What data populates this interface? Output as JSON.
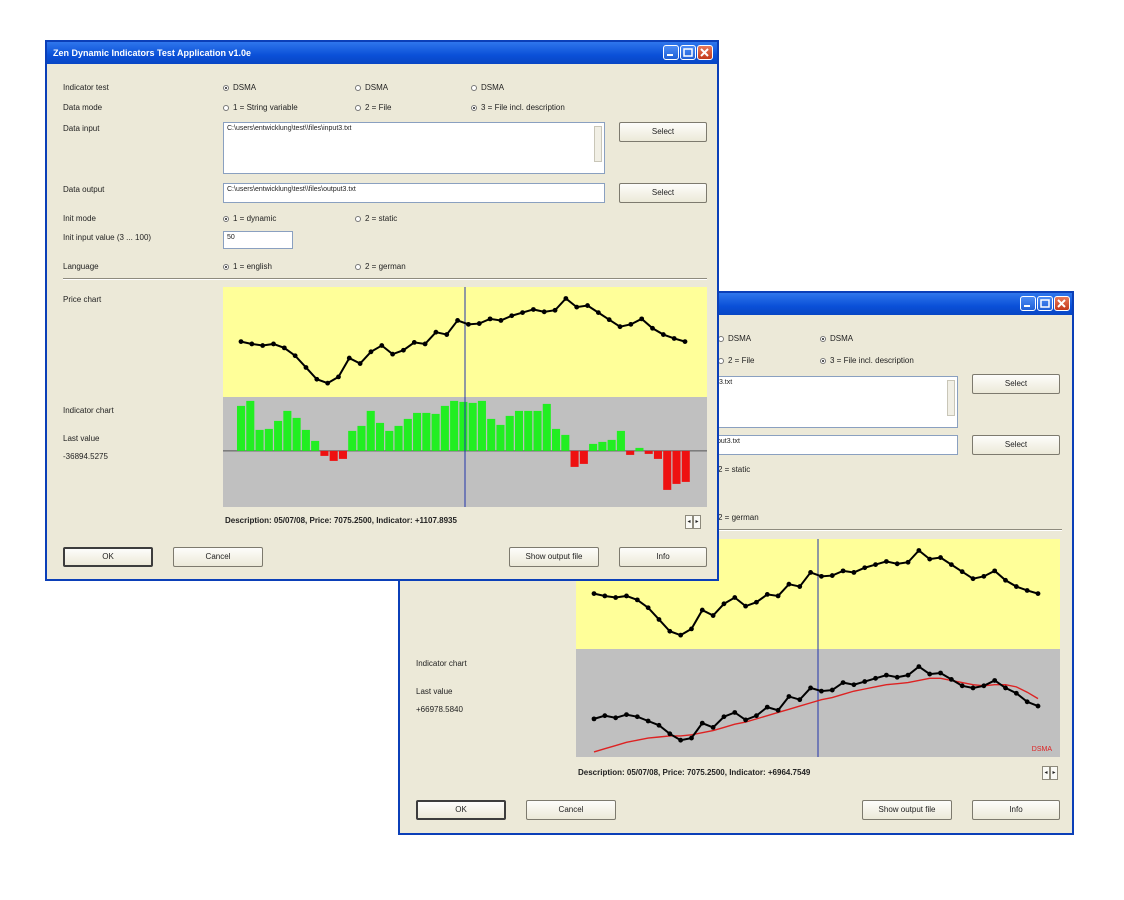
{
  "window1": {
    "title": "Zen Dynamic Indicators Test Application v1.0e",
    "labels": {
      "indicator_test": "Indicator test",
      "data_mode": "Data mode",
      "data_input": "Data input",
      "data_output": "Data output",
      "init_mode": "Init mode",
      "init_input_value": "Init input value (3 ... 100)",
      "language": "Language",
      "price_chart": "Price chart",
      "indicator_chart": "Indicator chart",
      "last_value": "Last value",
      "last_value_number": "-36894.5275"
    },
    "indicator_options": [
      "DSMA",
      "DSMA",
      "DSMA"
    ],
    "indicator_selected": 0,
    "data_mode_options": [
      "1 = String variable",
      "2 = File",
      "3 = File incl. description"
    ],
    "data_mode_selected": 2,
    "data_input_value": "C:\\users\\entwicklung\\test\\\\files\\input3.txt",
    "data_output_value": "C:\\users\\entwicklung\\test\\\\files\\output3.txt",
    "init_mode_options": [
      "1 = dynamic",
      "2 = static"
    ],
    "init_mode_selected": 0,
    "init_input_value": "50",
    "language_options": [
      "1 = english",
      "2 = german"
    ],
    "language_selected": 0,
    "select_label": "Select",
    "description": "Description:  05/07/08,  Price:  7075.2500,  Indicator:  +1107.8935",
    "buttons": {
      "ok": "OK",
      "cancel": "Cancel",
      "show_output": "Show output file",
      "info": "Info"
    }
  },
  "window2": {
    "indicator_options": [
      "DSMA",
      "DSMA"
    ],
    "indicator_selected": 1,
    "data_mode_options": [
      "2 = File",
      "3 = File incl. description"
    ],
    "data_mode_selected": 1,
    "data_input_value": "t3.txt",
    "data_output_value": "put3.txt",
    "init_mode_option": "2 = static",
    "language_option": "2 = german",
    "select_label": "Select",
    "labels": {
      "indicator_chart": "Indicator chart",
      "last_value": "Last value",
      "last_value_number": "+66978.5840"
    },
    "legend_label": "DSMA",
    "description": "Description:  05/07/08,  Price:  7075.2500,  Indicator:  +6964.7549",
    "buttons": {
      "ok": "OK",
      "cancel": "Cancel",
      "show_output": "Show output file",
      "info": "Info"
    }
  },
  "colors": {
    "title_bar": "#0a50d8",
    "price_bg": "#ffff99",
    "indicator_bg": "#c0c0c0",
    "bar_positive": "#22ee22",
    "bar_negative": "#ee1111",
    "cursor_line": "#2233aa",
    "signal_line": "#dd2222"
  },
  "chart_data": [
    {
      "type": "line",
      "name": "price_chart",
      "values": [
        6.3,
        6.0,
        5.8,
        6.0,
        5.5,
        4.5,
        3.0,
        1.5,
        1.0,
        1.8,
        4.2,
        3.5,
        5.0,
        5.8,
        4.7,
        5.2,
        6.2,
        6.0,
        7.5,
        7.2,
        9.0,
        8.5,
        8.6,
        9.2,
        9.0,
        9.6,
        10.0,
        10.4,
        10.1,
        10.3,
        11.8,
        10.7,
        10.9,
        10.0,
        9.1,
        8.2,
        8.5,
        9.2,
        8.0,
        7.2,
        6.7,
        6.3
      ]
    },
    {
      "type": "bar",
      "name": "indicator_chart",
      "values": [
        4.5,
        5.0,
        2.1,
        2.2,
        3.0,
        4.0,
        3.3,
        2.1,
        1.0,
        -0.5,
        -1.0,
        -0.8,
        2.0,
        2.5,
        4.0,
        2.8,
        2.0,
        2.5,
        3.2,
        3.8,
        3.8,
        3.7,
        4.5,
        5.0,
        4.9,
        4.8,
        5.0,
        3.2,
        2.6,
        3.5,
        4.0,
        4.0,
        4.0,
        4.7,
        2.2,
        1.6,
        -1.6,
        -1.3,
        0.7,
        0.9,
        1.1,
        2.0,
        -0.4,
        0.3,
        -0.3,
        -0.8,
        -3.9,
        -3.3,
        -3.1
      ]
    },
    {
      "type": "line",
      "name": "indicator_chart_2",
      "series": [
        {
          "values": [
            3.2,
            3.5,
            3.3,
            3.6,
            3.4,
            3.0,
            2.6,
            1.8,
            1.2,
            1.4,
            2.8,
            2.4,
            3.4,
            3.8,
            3.1,
            3.5,
            4.3,
            4.0,
            5.3,
            5.0,
            6.1,
            5.8,
            5.9,
            6.6,
            6.4,
            6.7,
            7.0,
            7.3,
            7.1,
            7.3,
            8.1,
            7.4,
            7.5,
            6.9,
            6.3,
            6.1,
            6.3,
            6.8,
            6.1,
            5.6,
            4.8,
            4.4
          ]
        },
        {
          "values": [
            0.1,
            0.4,
            0.7,
            1.0,
            1.2,
            1.4,
            1.5,
            1.6,
            1.6,
            1.7,
            1.9,
            2.1,
            2.4,
            2.7,
            2.9,
            3.2,
            3.5,
            3.8,
            4.1,
            4.4,
            4.7,
            5.0,
            5.2,
            5.5,
            5.8,
            6.0,
            6.2,
            6.4,
            6.5,
            6.6,
            6.8,
            7.0,
            7.0,
            6.8,
            6.6,
            6.4,
            6.3,
            6.4,
            6.4,
            6.2,
            5.7,
            5.1
          ]
        }
      ]
    }
  ]
}
